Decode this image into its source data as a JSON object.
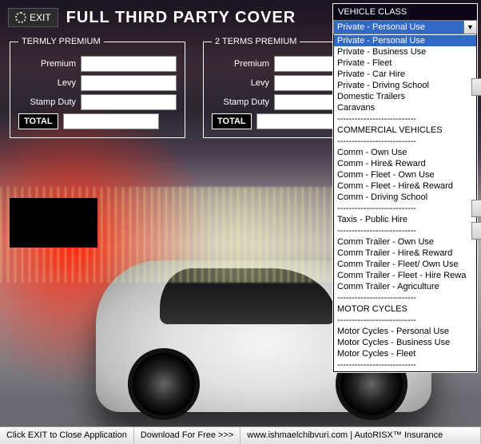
{
  "header": {
    "exit_label": "EXIT",
    "title": "FULL THIRD PARTY COVER"
  },
  "premium_panels": [
    {
      "legend": "TERMLY PREMIUM",
      "rows": [
        {
          "label": "Premium",
          "value": ""
        },
        {
          "label": "Levy",
          "value": ""
        },
        {
          "label": "Stamp Duty",
          "value": ""
        }
      ],
      "total_label": "TOTAL",
      "total_value": ""
    },
    {
      "legend": "2 TERMS PREMIUM",
      "rows": [
        {
          "label": "Premium",
          "value": ""
        },
        {
          "label": "Levy",
          "value": ""
        },
        {
          "label": "Stamp Duty",
          "value": ""
        }
      ],
      "total_label": "TOTAL",
      "total_value": ""
    }
  ],
  "vehicle_class": {
    "label": "VEHICLE CLASS",
    "selected": "Private - Personal Use",
    "options": [
      {
        "text": "Private - Personal Use",
        "highlight": true
      },
      {
        "text": "Private - Business Use"
      },
      {
        "text": "Private - Fleet"
      },
      {
        "text": "Private - Car Hire"
      },
      {
        "text": "Private - Driving School"
      },
      {
        "text": "Domestic Trailers"
      },
      {
        "text": "Caravans"
      },
      {
        "text": "---------------------------",
        "sep": true
      },
      {
        "text": "COMMERCIAL VEHICLES"
      },
      {
        "text": "---------------------------",
        "sep": true
      },
      {
        "text": "Comm - Own Use"
      },
      {
        "text": "Comm - Hire& Reward"
      },
      {
        "text": "Comm - Fleet - Own Use"
      },
      {
        "text": "Comm - Fleet - Hire& Reward"
      },
      {
        "text": "Comm - Driving School"
      },
      {
        "text": "---------------------------",
        "sep": true
      },
      {
        "text": "Taxis - Public Hire"
      },
      {
        "text": "---------------------------",
        "sep": true
      },
      {
        "text": "Comm Trailer - Own Use"
      },
      {
        "text": "Comm Trailer - Hire& Reward"
      },
      {
        "text": "Comm Trailer - Fleet/ Own Use"
      },
      {
        "text": "Comm Trailer - Fleet - Hire Rewa"
      },
      {
        "text": "Comm Trailer - Agriculture"
      },
      {
        "text": "---------------------------",
        "sep": true
      },
      {
        "text": "MOTOR CYCLES"
      },
      {
        "text": "---------------------------",
        "sep": true
      },
      {
        "text": "Motor Cycles - Personal Use"
      },
      {
        "text": "Motor Cycles - Business Use"
      },
      {
        "text": "Motor Cycles - Fleet"
      },
      {
        "text": "---------------------------",
        "sep": true
      }
    ]
  },
  "status": {
    "seg1": "Click EXIT to Close Application",
    "seg2": "Download For Free >>>",
    "seg3": "www.ishmaelchibvuri.com | AutoRISX™ Insurance"
  }
}
